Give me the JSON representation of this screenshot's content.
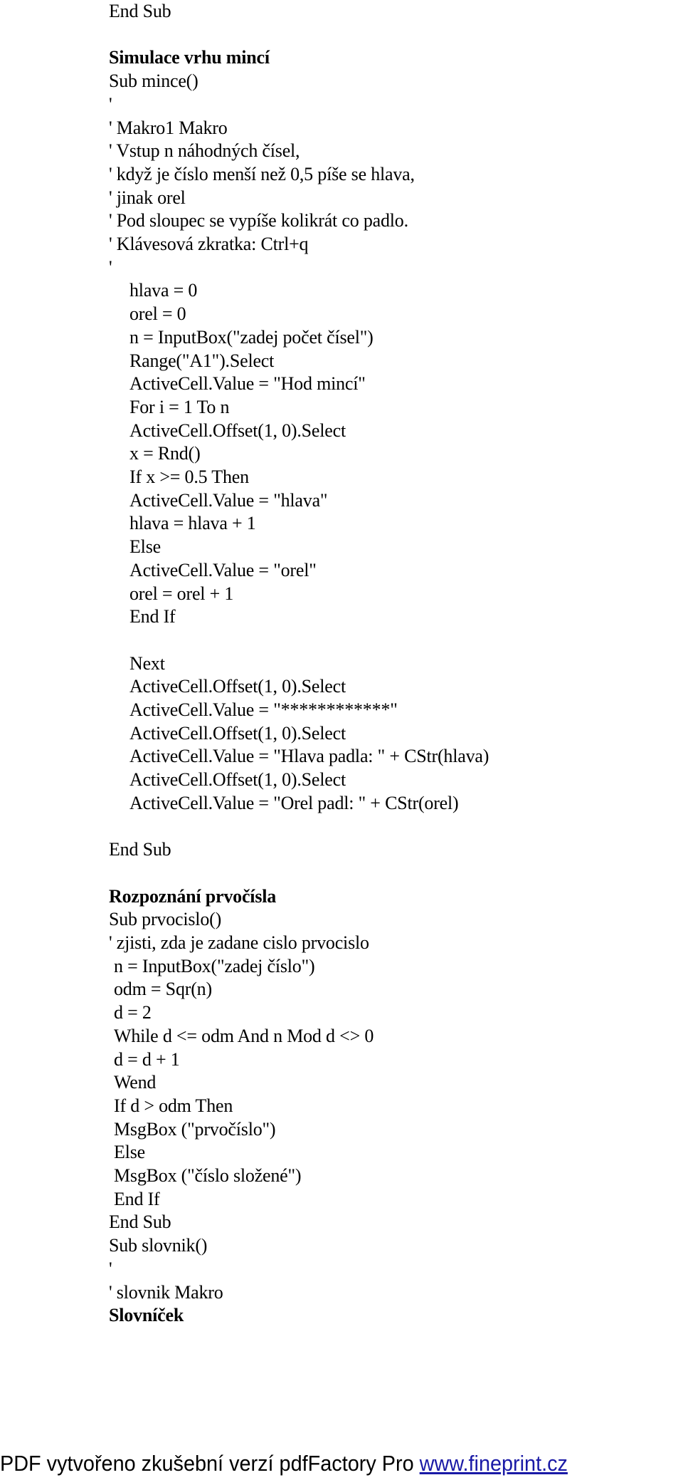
{
  "document": {
    "lines": [
      {
        "text": "End Sub",
        "style": "normal",
        "indent": 0
      },
      {
        "text": "",
        "style": "normal",
        "indent": 0
      },
      {
        "text": "Simulace vrhu mincí",
        "style": "heading",
        "indent": 0
      },
      {
        "text": "Sub mince()",
        "style": "normal",
        "indent": 0
      },
      {
        "text": "'",
        "style": "normal",
        "indent": 0
      },
      {
        "text": "' Makro1 Makro",
        "style": "normal",
        "indent": 0
      },
      {
        "text": "' Vstup n náhodných čísel,",
        "style": "normal",
        "indent": 0
      },
      {
        "text": "' když je číslo menší než 0,5 píše se hlava,",
        "style": "normal",
        "indent": 0
      },
      {
        "text": "' jinak orel",
        "style": "normal",
        "indent": 0
      },
      {
        "text": "' Pod sloupec se vypíše kolikrát co padlo.",
        "style": "normal",
        "indent": 0
      },
      {
        "text": "' Klávesová zkratka: Ctrl+q",
        "style": "normal",
        "indent": 0
      },
      {
        "text": "'",
        "style": "normal",
        "indent": 0
      },
      {
        "text": "hlava = 0",
        "style": "normal",
        "indent": 2
      },
      {
        "text": "orel = 0",
        "style": "normal",
        "indent": 2
      },
      {
        "text": "n = InputBox(\"zadej počet čísel\")",
        "style": "normal",
        "indent": 2
      },
      {
        "text": "Range(\"A1\").Select",
        "style": "normal",
        "indent": 2
      },
      {
        "text": "ActiveCell.Value = \"Hod mincí\"",
        "style": "normal",
        "indent": 2
      },
      {
        "text": "For i = 1 To n",
        "style": "normal",
        "indent": 2
      },
      {
        "text": "ActiveCell.Offset(1, 0).Select",
        "style": "normal",
        "indent": 2
      },
      {
        "text": "x = Rnd()",
        "style": "normal",
        "indent": 2
      },
      {
        "text": "If x >= 0.5 Then",
        "style": "normal",
        "indent": 2
      },
      {
        "text": "ActiveCell.Value = \"hlava\"",
        "style": "normal",
        "indent": 2
      },
      {
        "text": "hlava = hlava + 1",
        "style": "normal",
        "indent": 2
      },
      {
        "text": "Else",
        "style": "normal",
        "indent": 2
      },
      {
        "text": "ActiveCell.Value = \"orel\"",
        "style": "normal",
        "indent": 2
      },
      {
        "text": "orel = orel + 1",
        "style": "normal",
        "indent": 2
      },
      {
        "text": "End If",
        "style": "normal",
        "indent": 2
      },
      {
        "text": "",
        "style": "normal",
        "indent": 0
      },
      {
        "text": "Next",
        "style": "normal",
        "indent": 2
      },
      {
        "text": "ActiveCell.Offset(1, 0).Select",
        "style": "normal",
        "indent": 2
      },
      {
        "text": "ActiveCell.Value = \"************\"",
        "style": "normal",
        "indent": 2
      },
      {
        "text": "ActiveCell.Offset(1, 0).Select",
        "style": "normal",
        "indent": 2
      },
      {
        "text": "ActiveCell.Value = \"Hlava padla: \" + CStr(hlava)",
        "style": "normal",
        "indent": 2
      },
      {
        "text": "ActiveCell.Offset(1, 0).Select",
        "style": "normal",
        "indent": 2
      },
      {
        "text": "ActiveCell.Value = \"Orel padl: \" + CStr(orel)",
        "style": "normal",
        "indent": 2
      },
      {
        "text": "",
        "style": "normal",
        "indent": 0
      },
      {
        "text": "End Sub",
        "style": "normal",
        "indent": 0
      },
      {
        "text": "",
        "style": "normal",
        "indent": 0
      },
      {
        "text": "Rozpoznání prvočísla",
        "style": "heading",
        "indent": 0
      },
      {
        "text": "Sub prvocislo()",
        "style": "normal",
        "indent": 0
      },
      {
        "text": "' zjisti, zda je zadane cislo prvocislo",
        "style": "normal",
        "indent": 0
      },
      {
        "text": "n = InputBox(\"zadej číslo\")",
        "style": "normal",
        "indent": 1
      },
      {
        "text": "odm = Sqr(n)",
        "style": "normal",
        "indent": 1
      },
      {
        "text": "d = 2",
        "style": "normal",
        "indent": 1
      },
      {
        "text": "While d <= odm And n Mod d <> 0",
        "style": "normal",
        "indent": 1
      },
      {
        "text": "d = d + 1",
        "style": "normal",
        "indent": 1
      },
      {
        "text": "Wend",
        "style": "normal",
        "indent": 1
      },
      {
        "text": "If d > odm Then",
        "style": "normal",
        "indent": 1
      },
      {
        "text": "MsgBox (\"prvočíslo\")",
        "style": "normal",
        "indent": 1
      },
      {
        "text": "Else",
        "style": "normal",
        "indent": 1
      },
      {
        "text": "MsgBox (\"číslo složené\")",
        "style": "normal",
        "indent": 1
      },
      {
        "text": "End If",
        "style": "normal",
        "indent": 1
      },
      {
        "text": "End Sub",
        "style": "normal",
        "indent": 0
      },
      {
        "text": "Sub slovnik()",
        "style": "normal",
        "indent": 0
      },
      {
        "text": "'",
        "style": "normal",
        "indent": 0
      },
      {
        "text": "' slovnik Makro",
        "style": "normal",
        "indent": 0
      },
      {
        "text": "Slovníček",
        "style": "heading",
        "indent": 0
      }
    ]
  },
  "footer": {
    "text": "PDF vytvořeno zkušební verzí pdfFactory Pro ",
    "link_text": "www.fineprint.cz",
    "link_color": "#1a1aa6"
  }
}
